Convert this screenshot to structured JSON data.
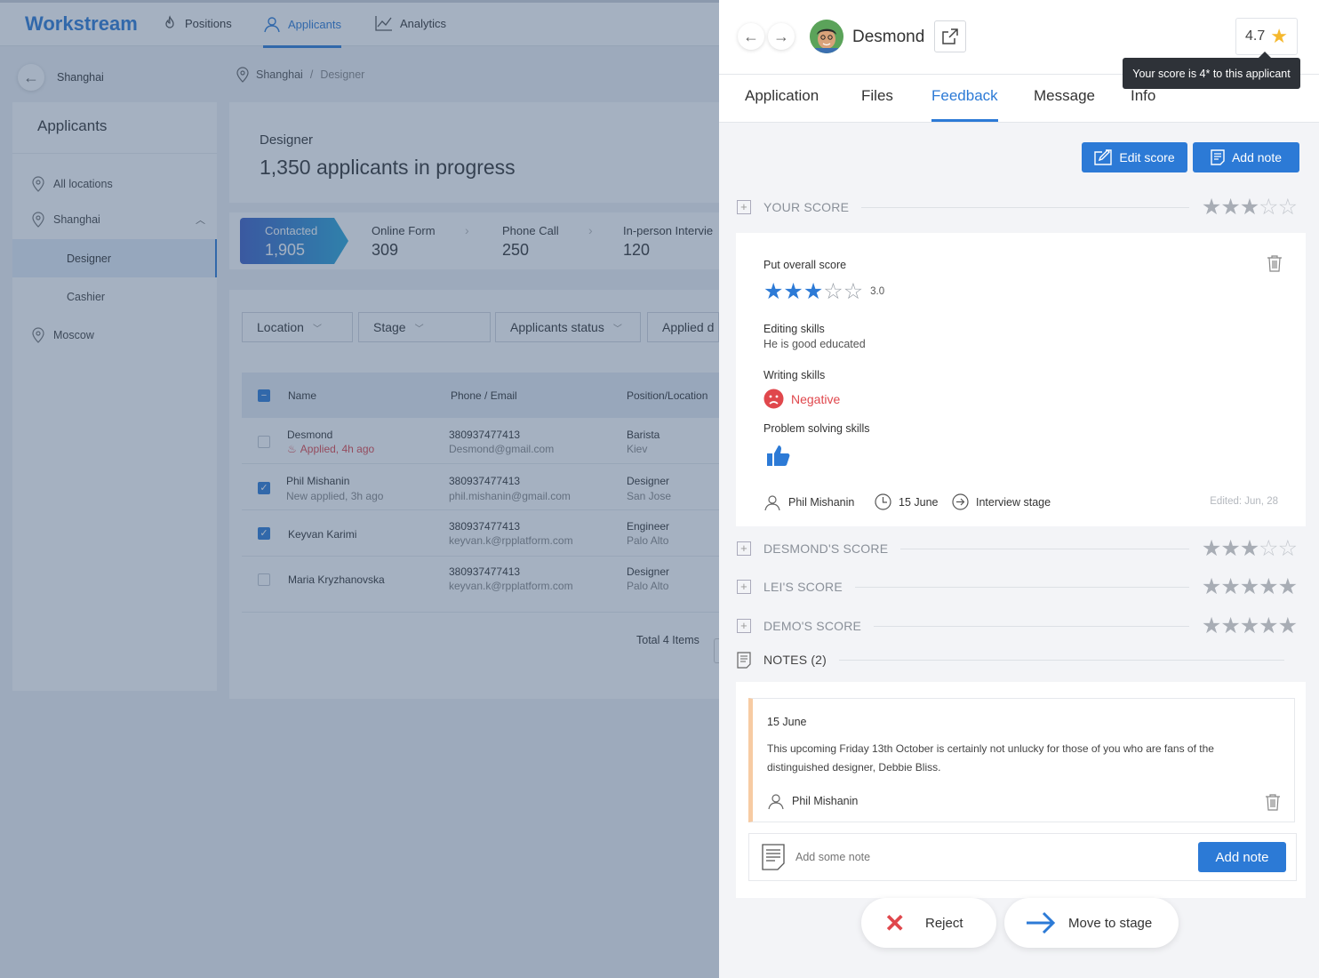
{
  "app": {
    "logo": "Workstream",
    "nav": [
      "Positions",
      "Applicants",
      "Analytics"
    ],
    "back_location": "Shanghai",
    "breadcrumb": {
      "city": "Shanghai",
      "sep": "/",
      "position": "Designer"
    }
  },
  "sidebar": {
    "title": "Applicants",
    "items": [
      "All locations",
      "Shanghai",
      "Designer",
      "Cashier",
      "Moscow"
    ]
  },
  "summary": {
    "position": "Designer",
    "count_text": "1,350 applicants in progress"
  },
  "stages": [
    {
      "label": "Contacted",
      "value": "1,905"
    },
    {
      "label": "Online Form",
      "value": "309"
    },
    {
      "label": "Phone Call",
      "value": "250"
    },
    {
      "label": "In-person Intervie",
      "value": "120"
    }
  ],
  "filters": [
    "Location",
    "Stage",
    "Applicants status",
    "Applied d"
  ],
  "table": {
    "headers": [
      "Name",
      "Phone / Email",
      "Position/Location"
    ],
    "rows": [
      {
        "name": "Desmond",
        "status": "Applied, 4h ago",
        "phone": "380937477413",
        "email": "Desmond@gmail.com",
        "position": "Barista",
        "location": "Kiev",
        "checked": false
      },
      {
        "name": "Phil Mishanin",
        "status": "New applied, 3h ago",
        "phone": "380937477413",
        "email": "phil.mishanin@gmail.com",
        "position": "Designer",
        "location": "San Jose",
        "checked": true
      },
      {
        "name": "Keyvan Karimi",
        "status": "",
        "phone": "380937477413",
        "email": "keyvan.k@rpplatform.com",
        "position": "Engineer",
        "location": "Palo Alto",
        "checked": true
      },
      {
        "name": "Maria Kryzhanovska",
        "status": "",
        "phone": "380937477413",
        "email": "keyvan.k@rpplatform.com",
        "position": "Designer",
        "location": "Palo Alto",
        "checked": false
      }
    ],
    "total": "Total 4 Items"
  },
  "panel": {
    "applicant_name": "Desmond",
    "rating": "4.7",
    "tooltip": "Your score is 4* to this applicant",
    "tabs": [
      "Application",
      "Files",
      "Feedback",
      "Message",
      "Info"
    ],
    "edit_score": "Edit score",
    "add_note": "Add note",
    "your_score": {
      "heading": "YOUR SCORE",
      "stars": 3
    },
    "score_card": {
      "overall_label": "Put overall score",
      "overall_value": "3.0",
      "overall_stars": 3,
      "skills": [
        {
          "name": "Editing skills",
          "value": "He is good educated"
        },
        {
          "name": "Writing skills",
          "value": "Negative"
        },
        {
          "name": "Problem solving skills",
          "value": ""
        }
      ],
      "author": "Phil Mishanin",
      "date": "15 June",
      "stage": "Interview stage",
      "edited": "Edited: Jun, 28"
    },
    "other_scores": [
      {
        "heading": "DESMOND'S SCORE",
        "stars": 3
      },
      {
        "heading": "LEI'S SCORE",
        "stars": 5
      },
      {
        "heading": "DEMO'S SCORE",
        "stars": 5
      }
    ],
    "notes": {
      "heading": "NOTES (2)",
      "date": "15 June",
      "text": "This upcoming Friday 13th October is certainly not unlucky for those of you who are fans of the distinguished designer, Debbie Bliss.",
      "author": "Phil Mishanin",
      "placeholder": "Add some note",
      "button": "Add note"
    },
    "reject": "Reject",
    "move": "Move to stage"
  },
  "colors": {
    "accent": "#2c7ad6",
    "negative": "#e0474c",
    "star": "#f5b82e"
  }
}
